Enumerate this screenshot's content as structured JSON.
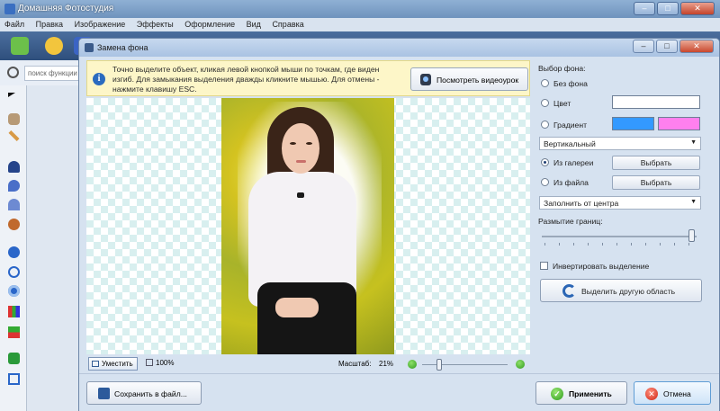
{
  "app": {
    "title": "Домашняя Фотостудия",
    "menu": [
      "Файл",
      "Правка",
      "Изображение",
      "Эффекты",
      "Оформление",
      "Вид",
      "Справка"
    ],
    "window_controls": {
      "minimize": "–",
      "maximize": "□",
      "close": "✕"
    },
    "search": {
      "placeholder": "поиск функции"
    }
  },
  "dialog": {
    "title": "Замена фона",
    "window_controls": {
      "minimize": "–",
      "maximize": "□",
      "close": "✕"
    },
    "hint": {
      "icon": "i",
      "text": "Точно выделите объект, кликая левой кнопкой мыши по точкам, где виден изгиб. Для замыкания выделения дважды кликните мышью. Для отмены - нажмите клавишу ESC.",
      "video_button": "Посмотреть видеоурок"
    },
    "zoom": {
      "fit_button": "Уместить",
      "actual_size": "100%",
      "scale_label": "Масштаб:",
      "scale_value": "21%",
      "slider_fraction": 0.2
    },
    "background_panel": {
      "title": "Выбор фона:",
      "options": {
        "none": "Без фона",
        "color": "Цвет",
        "gradient": "Градиент",
        "gallery": "Из галереи",
        "file": "Из файла"
      },
      "selected": "gallery",
      "colors": {
        "solid": "#ffffff",
        "gradient_start": "#3399ff",
        "gradient_end": "#ff80ee"
      },
      "gradient_direction": "Вертикальный",
      "choose_label": "Выбрать",
      "fill_mode": "Заполнить от центра",
      "edge_blur_label": "Размытие границ:",
      "edge_blur_fraction": 0.97,
      "invert_label": "Инвертировать выделение",
      "invert_checked": false,
      "select_other_button": "Выделить другую область"
    },
    "footer": {
      "save_button": "Сохранить в файл...",
      "apply_button": "Применить",
      "cancel_button": "Отмена"
    }
  }
}
